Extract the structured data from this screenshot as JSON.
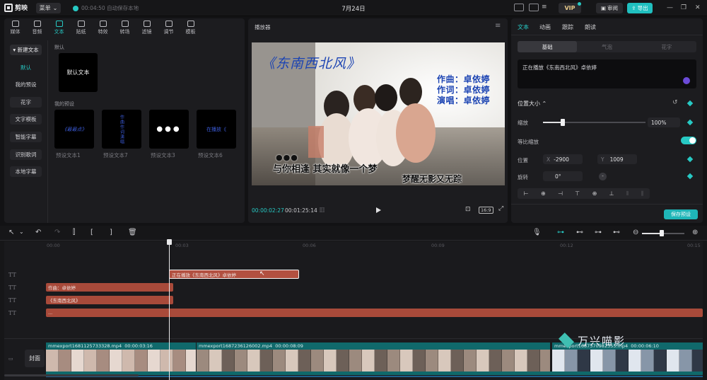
{
  "app": {
    "name": "剪映",
    "menu_label": "菜单",
    "autosave": "00:04:50 自动保存本地",
    "date_title": "7月24日"
  },
  "header": {
    "vip": "VIP",
    "review": "审阅",
    "export": "导出"
  },
  "tool_tabs": [
    {
      "label": "媒体",
      "icon": "media-icon"
    },
    {
      "label": "音频",
      "icon": "audio-icon"
    },
    {
      "label": "文本",
      "icon": "text-icon",
      "active": true
    },
    {
      "label": "贴纸",
      "icon": "sticker-icon"
    },
    {
      "label": "特效",
      "icon": "effects-icon"
    },
    {
      "label": "转场",
      "icon": "transition-icon"
    },
    {
      "label": "滤镜",
      "icon": "filter-icon"
    },
    {
      "label": "调节",
      "icon": "adjust-icon"
    },
    {
      "label": "模板",
      "icon": "template-icon"
    }
  ],
  "left_nav": [
    "▾ 新建文本",
    "默认",
    "我的预设",
    "花字",
    "文字模板",
    "智能字幕",
    "识别歌词",
    "本地字幕"
  ],
  "library": {
    "default_section": "默认",
    "default_card": "默认文本",
    "preset_section": "我的预设",
    "presets": [
      {
        "label": "预设文本1",
        "preview": "《最最点》"
      },
      {
        "label": "预设文本7",
        "preview": "作曲作词演唱"
      },
      {
        "label": "预设文本3",
        "preview": "●●●"
      },
      {
        "label": "预设文本6",
        "preview": "在播放《"
      }
    ]
  },
  "player": {
    "title": "播放器",
    "time_current": "00:00:02:27",
    "time_total": "00:01:25:14",
    "ratio": "16:9",
    "overlay": {
      "song_title": "《东南西北风》",
      "credits": [
        "作曲：卓依婷",
        "作词：卓依婷",
        "演唱：卓依婷"
      ],
      "dots": "●●●",
      "lyric_1": "与你相逢 其实就像一个梦",
      "lyric_2": "梦醒无影又无踪"
    }
  },
  "inspector": {
    "tabs": [
      "文本",
      "动画",
      "跟踪",
      "朗读"
    ],
    "segments": [
      "基础",
      "气泡",
      "花字"
    ],
    "text_value": "正在播放《东南西北风》卓依婷",
    "section": "位置大小",
    "scale_label": "缩放",
    "scale_value": "100%",
    "scale_fraction": 0.19,
    "uniform_label": "等比缩放",
    "position_label": "位置",
    "x_label": "X",
    "x_value": "-2900",
    "y_label": "Y",
    "y_value": "1009",
    "rotate_label": "旋转",
    "rotate_value": "0°",
    "save_preset": "保存预设"
  },
  "timeline": {
    "ruler": [
      "00:00",
      "00:03",
      "00:06",
      "00:09",
      "00:12",
      "00:15"
    ],
    "text_clips": [
      {
        "label": "正在播放《东南西北风》卓依婷"
      },
      {
        "label": "作曲：卓依婷"
      },
      {
        "label": "《东南西北风》"
      },
      {
        "label": "..."
      }
    ],
    "video_clips": [
      {
        "name": "mmexport1681125733328.mp4",
        "duration": "00:00:03:16"
      },
      {
        "name": "mmexport1687236126002.mp4",
        "duration": "00:00:08:09"
      },
      {
        "name": "mmexport1687370982355.mp4",
        "duration": "00:00:06:10"
      }
    ],
    "cover_label": "封面"
  },
  "watermark": "万兴喵影",
  "colors": {
    "accent": "#27c9c4",
    "text_clip": "#a84a3a",
    "video_clip": "#10696b"
  }
}
